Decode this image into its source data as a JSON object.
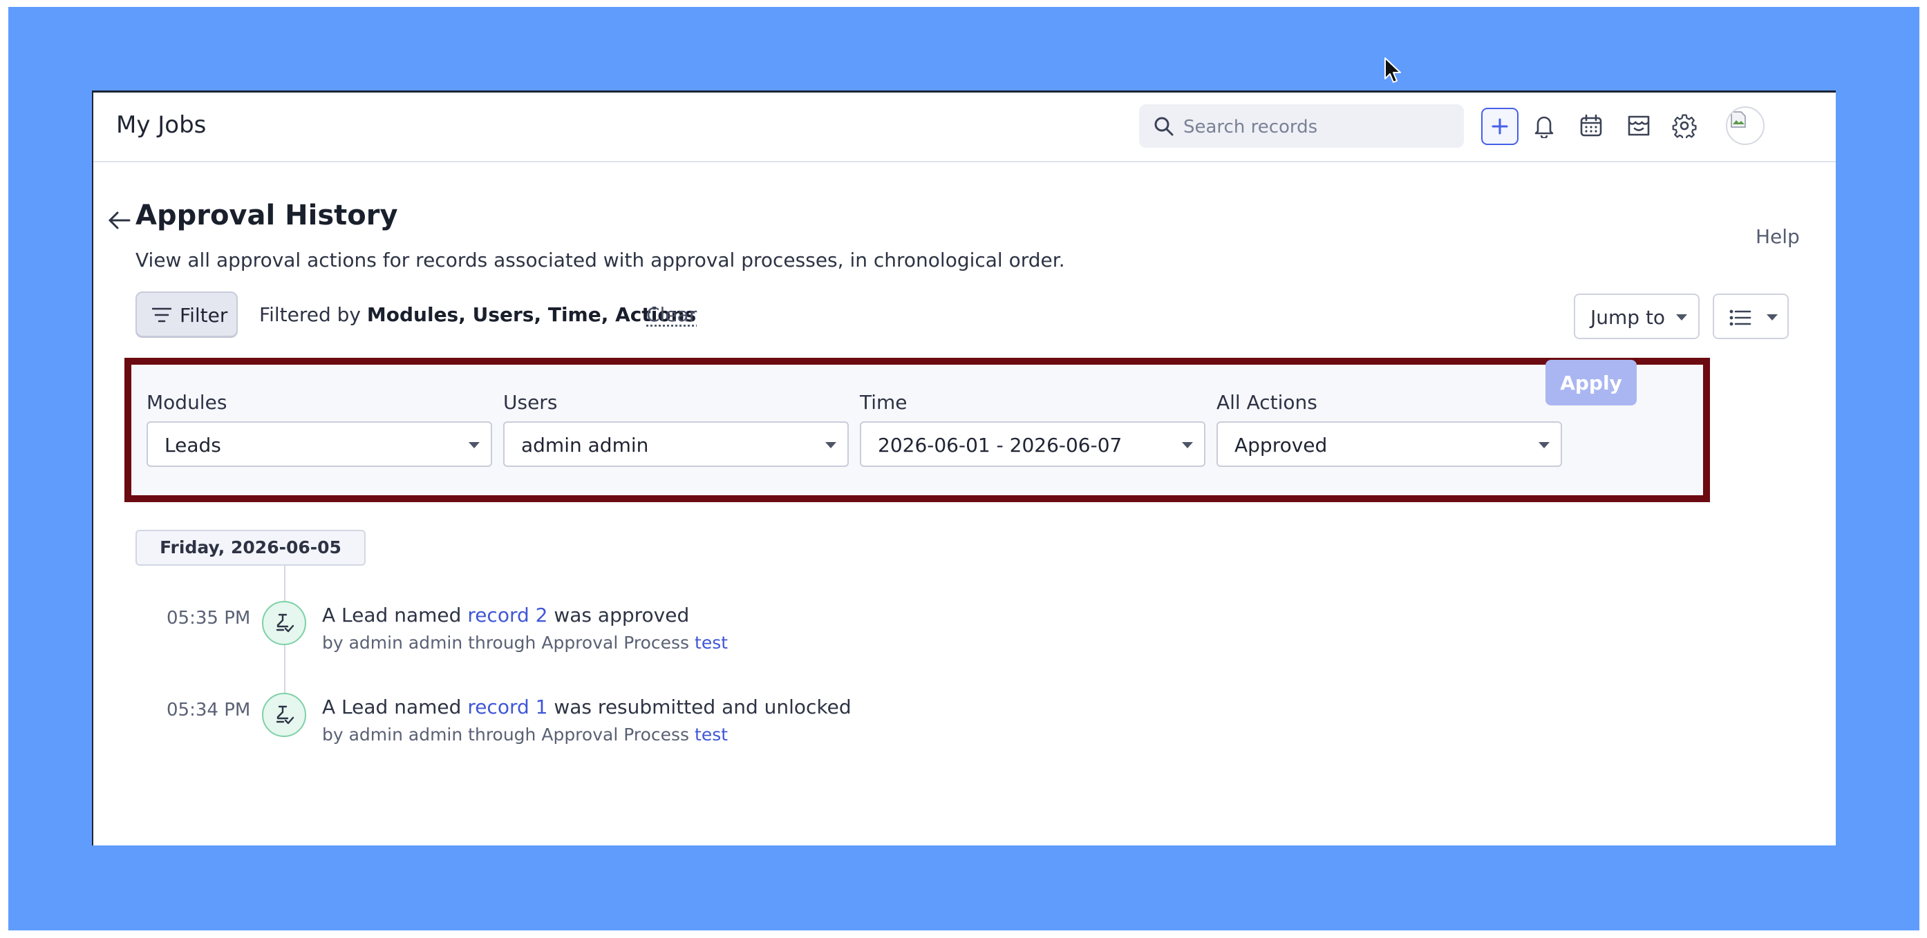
{
  "header": {
    "app_title": "My Jobs",
    "search_placeholder": "Search records"
  },
  "page": {
    "title": "Approval History",
    "subtitle": "View all approval actions for records associated with approval processes, in chronological order.",
    "help_label": "Help"
  },
  "toolbar": {
    "filter_label": "Filter",
    "filtered_by_prefix": "Filtered by",
    "filtered_by_values": "Modules, Users, Time, Actions",
    "clear_label": "Clear",
    "jump_to_label": "Jump to"
  },
  "filters": {
    "modules": {
      "label": "Modules",
      "value": "Leads"
    },
    "users": {
      "label": "Users",
      "value": "admin admin"
    },
    "time": {
      "label": "Time",
      "value": "2026-06-01 - 2026-06-07"
    },
    "actions": {
      "label": "All Actions",
      "value": "Approved"
    },
    "apply_label": "Apply"
  },
  "timeline": {
    "date": "Friday, 2026-06-05",
    "entries": [
      {
        "time": "05:35 PM",
        "prefix": "A Lead named",
        "record": "record 2",
        "suffix": "was approved",
        "by_prefix": "by admin admin through Approval Process",
        "process": "test"
      },
      {
        "time": "05:34 PM",
        "prefix": "A Lead named",
        "record": "record 1",
        "suffix": "was resubmitted and unlocked",
        "by_prefix": "by admin admin through Approval Process",
        "process": "test"
      }
    ]
  },
  "colors": {
    "backdrop": "#609cfc",
    "accent": "#4460e6",
    "highlight_border": "#6b0a10",
    "apply_disabled": "#aab6f2",
    "approval_badge": "#e5f7ee"
  },
  "icons": [
    "search-icon",
    "plus-icon",
    "bell-icon",
    "calendar-icon",
    "marketplace-icon",
    "gear-icon",
    "avatar",
    "back-arrow-icon",
    "filter-icon",
    "list-view-icon",
    "approval-icon"
  ]
}
